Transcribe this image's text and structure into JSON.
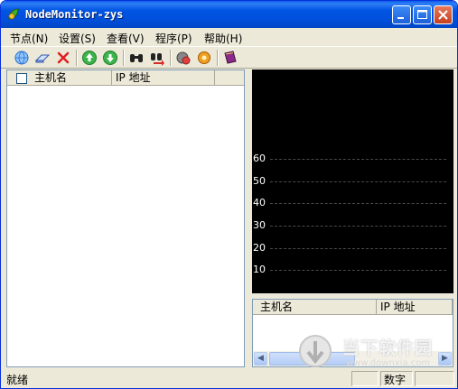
{
  "window": {
    "title": "NodeMonitor-zys"
  },
  "colors": {
    "titlebar": "#0054e3",
    "graph_bg": "#000000",
    "menu_bg": "#ece9d8"
  },
  "menubar": {
    "items": [
      {
        "label": "节点(N)"
      },
      {
        "label": "设置(S)"
      },
      {
        "label": "查看(V)"
      },
      {
        "label": "程序(P)"
      },
      {
        "label": "帮助(H)"
      }
    ]
  },
  "toolbar": {
    "icons": [
      "globe-icon",
      "eraser-icon",
      "delete-x-icon",
      "arrow-up-icon",
      "arrow-down-icon",
      "binoculars-icon",
      "find-next-icon",
      "stop-icon",
      "settings-gear-icon",
      "book-icon"
    ]
  },
  "left_list": {
    "columns": [
      "主机名",
      "IP 地址"
    ]
  },
  "graph": {
    "y_labels": [
      "60",
      "50",
      "40",
      "30",
      "20",
      "10"
    ]
  },
  "right_list": {
    "columns": [
      "主机名",
      "IP 地址"
    ]
  },
  "statusbar": {
    "text": "就绪",
    "num_lock": "数字"
  },
  "watermark": {
    "text": "当下软件园",
    "sub": "www.downxia.com"
  }
}
